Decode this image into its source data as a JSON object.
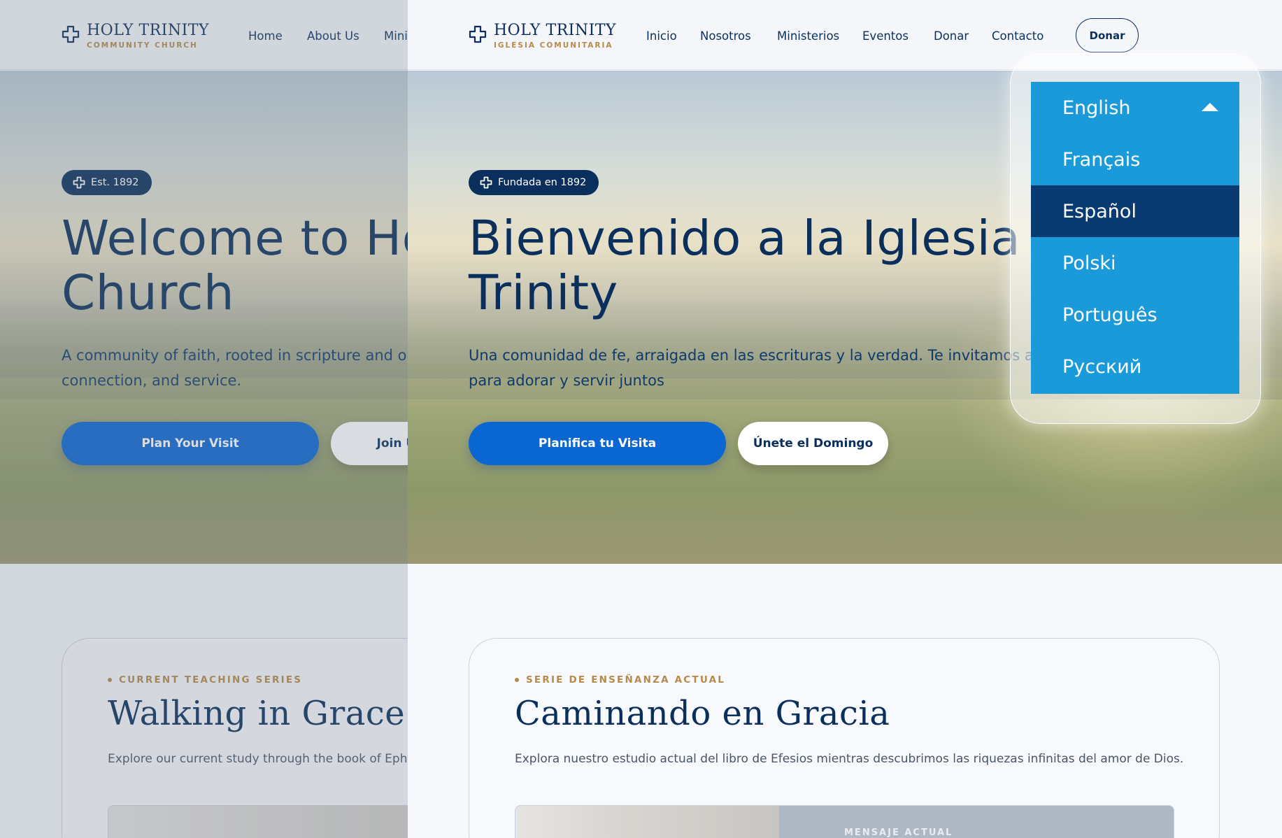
{
  "english_page": {
    "logo": {
      "title": "HOLY TRINITY",
      "subtitle": "COMMUNITY CHURCH"
    },
    "nav": [
      "Home",
      "About Us",
      "Mini"
    ],
    "badge": "Est. 1892",
    "hero": {
      "title_line1": "Welcome to Ho",
      "title_line2": "Church",
      "subtitle_line1": "A community of faith, rooted in scripture and op",
      "subtitle_line2": "connection, and service.",
      "primary_button": "Plan Your Visit",
      "secondary_button": "Join Us S"
    },
    "series": {
      "eyebrow": "CURRENT TEACHING SERIES",
      "title": "Walking in Grace",
      "description": "Explore our current study through the book of Ephesi"
    }
  },
  "spanish_page": {
    "logo": {
      "title": "HOLY TRINITY",
      "subtitle": "IGLESIA COMUNITARIA"
    },
    "nav": [
      "Inicio",
      "Nosotros",
      "Ministerios",
      "Eventos",
      "Donar",
      "Contacto"
    ],
    "donate_button": "Donar",
    "badge": "Fundada en 1892",
    "hero": {
      "title_line1": "Bienvenido a la Iglesia H",
      "title_line2": "Trinity",
      "subtitle_line1": "Una comunidad de fe, arraigada en las escrituras y la verdad. Te invitamos a u",
      "subtitle_line2": "para adorar y servir juntos",
      "primary_button": "Planifica tu Visita",
      "secondary_button": "Únete el Domingo"
    },
    "series": {
      "eyebrow": "SERIE DE ENSEÑANZA ACTUAL",
      "title": "Caminando en Gracia",
      "description": "Explora nuestro estudio actual del libro de Efesios mientras descubrimos las riquezas infinitas del amor de Dios.",
      "media_label": "MENSAJE ACTUAL"
    }
  },
  "language_dropdown": {
    "options": [
      "English",
      "Français",
      "Español",
      "Polski",
      "Português",
      "Русский"
    ],
    "selected": "Español",
    "expanded": true
  },
  "colors": {
    "navy": "#0b2f5c",
    "primary_blue": "#0a66d1",
    "gold": "#b58a4a",
    "dropdown_blue": "#1a9ad9",
    "dropdown_selected": "#0a3a72"
  },
  "icons": {
    "logo": "cross-icon",
    "badge": "cross-icon",
    "dropdown_caret": "caret-up-icon"
  }
}
